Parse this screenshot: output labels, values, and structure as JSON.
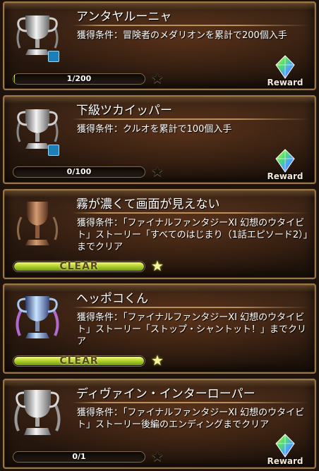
{
  "reward_label": "Reward",
  "cards": [
    {
      "title": "アンタヤルーニャ",
      "description": "獲得条件：冒険者のメダリオンを累計で200個入手",
      "progress_text": "1/200",
      "progress": 0.005,
      "trophy": "silver-trophy-icon",
      "locked": true,
      "cleared": false,
      "has_reward": true
    },
    {
      "title": "下級ツカイッパー",
      "description": "獲得条件：クルオを累計で100個入手",
      "progress_text": "0/100",
      "progress": 0,
      "trophy": "silver-trophy-icon",
      "locked": true,
      "cleared": false,
      "has_reward": true
    },
    {
      "title": "霧が濃くて画面が見えない",
      "description": "獲得条件：「ファイナルファンタジーXI 幻想のウタイビト」ストーリー「すべてのはじまり（1話エピソード2）」までクリア",
      "progress_text": "CLEAR",
      "progress": 1,
      "trophy": "bronze-trophy-icon",
      "locked": false,
      "cleared": true,
      "has_reward": false
    },
    {
      "title": "ヘッポコくん",
      "description": "獲得条件：「ファイナルファンタジーXI 幻想のウタイビト」ストーリー「ストップ・シャントット！」までクリア",
      "progress_text": "CLEAR",
      "progress": 1,
      "trophy": "blue-trophy-icon",
      "locked": false,
      "cleared": true,
      "has_reward": false
    },
    {
      "title": "ディヴァイン・インターローパー",
      "description": "獲得条件：「ファイナルファンタジーXI 幻想のウタイビト」ストーリー後編のエンディングまでクリア",
      "progress_text": "0/1",
      "progress": 0,
      "trophy": "silver-trophy-icon",
      "locked": false,
      "cleared": false,
      "has_reward": true
    }
  ]
}
